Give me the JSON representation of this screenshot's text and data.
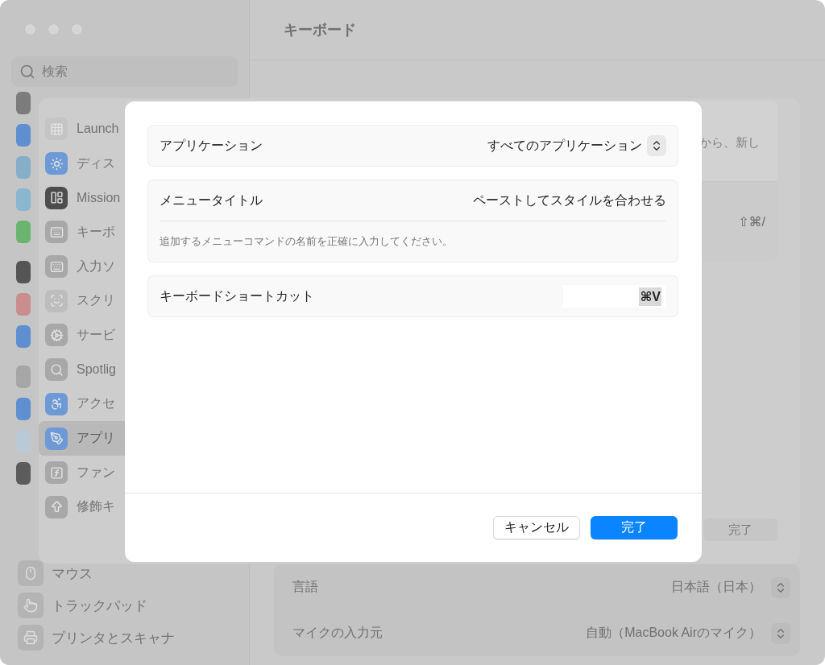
{
  "window": {
    "sidebar": {
      "search": {
        "placeholder": "検索"
      },
      "items": [
        {
          "label": "マウス"
        },
        {
          "label": "トラックパッド"
        },
        {
          "label": "プリンタとスキャナ"
        }
      ]
    },
    "title": "キーボード",
    "settings": [
      {
        "label": "言語",
        "value": "日本語（日本）"
      },
      {
        "label": "マイクの入力元",
        "value": "自動（MacBook Airのマイク）"
      }
    ]
  },
  "shortcuts_sheet": {
    "categories": [
      {
        "label": "Launch",
        "selected": false
      },
      {
        "label": "ディス",
        "selected": false
      },
      {
        "label": "Mission",
        "selected": false
      },
      {
        "label": "キーボ",
        "selected": false
      },
      {
        "label": "入力ソ",
        "selected": false
      },
      {
        "label": "スクリ",
        "selected": false
      },
      {
        "label": "サービ",
        "selected": false
      },
      {
        "label": "Spotlig",
        "selected": false
      },
      {
        "label": "アクセ",
        "selected": false
      },
      {
        "label": "アプリ",
        "selected": true
      },
      {
        "label": "ファン",
        "selected": false
      },
      {
        "label": "修飾キ",
        "selected": false
      }
    ],
    "description_fragment": "から、新し",
    "shortcut": "⇧⌘/",
    "done_button": "完了"
  },
  "dialog": {
    "groups": [
      {
        "kind": "popup",
        "label": "アプリケーション",
        "value": "すべてのアプリケーション"
      },
      {
        "kind": "text",
        "label": "メニュータイトル",
        "value": "ペーストしてスタイルを合わせる",
        "hint": "追加するメニューコマンドの名前を正確に入力してください。"
      },
      {
        "kind": "shortcut",
        "label": "キーボードショートカット",
        "value": "⌘V"
      }
    ],
    "buttons": [
      {
        "label": "キャンセル",
        "kind": "secondary"
      },
      {
        "label": "完了",
        "kind": "primary"
      }
    ]
  }
}
